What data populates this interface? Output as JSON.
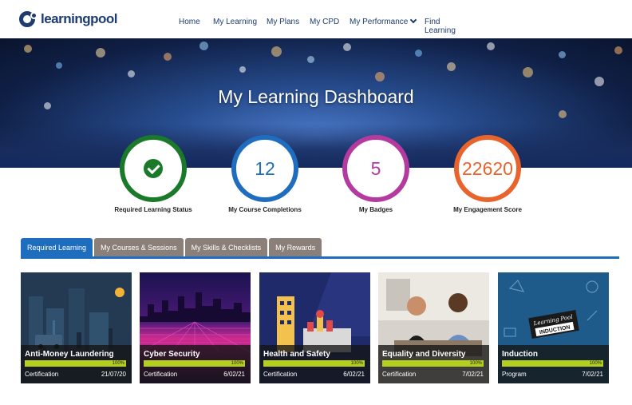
{
  "brand": {
    "logo_text": "learningpool",
    "color": "#1d3b6d"
  },
  "nav": {
    "items": [
      {
        "label": "Home"
      },
      {
        "label": "My Learning"
      },
      {
        "label": "My Plans"
      },
      {
        "label": "My CPD"
      },
      {
        "label": "My Performance",
        "has_dropdown": true
      },
      {
        "label": "Find Learning"
      }
    ]
  },
  "hero": {
    "title": "My Learning Dashboard"
  },
  "stats": [
    {
      "label": "Required Learning Status",
      "value": "",
      "icon": "check-circle-icon",
      "color": "#1a7a2a"
    },
    {
      "label": "My Course Completions",
      "value": "12",
      "color": "#1f6dbf"
    },
    {
      "label": "My Badges",
      "value": "5",
      "color": "#b43aa0"
    },
    {
      "label": "My Engagement Score",
      "value": "22620",
      "color": "#e8642c"
    }
  ],
  "tabs": [
    {
      "label": "Required Learning",
      "active": true
    },
    {
      "label": "My Courses & Sessions",
      "active": false
    },
    {
      "label": "My Skills & Checklists",
      "active": false
    },
    {
      "label": "My Rewards",
      "active": false
    }
  ],
  "courses": [
    {
      "title": "Anti-Money Laundering",
      "progress_label": "100%",
      "progress": 1.0,
      "type": "Certification",
      "date": "21/07/20"
    },
    {
      "title": "Cyber Security",
      "progress_label": "100%",
      "progress": 1.0,
      "type": "Certification",
      "date": "6/02/21"
    },
    {
      "title": "Health and Safety",
      "progress_label": "100%",
      "progress": 1.0,
      "type": "Certification",
      "date": "6/02/21"
    },
    {
      "title": "Equality and Diversity",
      "progress_label": "100%",
      "progress": 1.0,
      "type": "Certification",
      "date": "7/02/21"
    },
    {
      "title": "Induction",
      "progress_label": "100%",
      "progress": 1.0,
      "type": "Program",
      "date": "7/02/21"
    }
  ],
  "induction_sign": {
    "script": "Learning Pool",
    "word": "INDUCTION"
  },
  "colors": {
    "accent": "#1f6dbf",
    "tab_inactive": "#8a8079",
    "progress": "#b5cf1f"
  }
}
